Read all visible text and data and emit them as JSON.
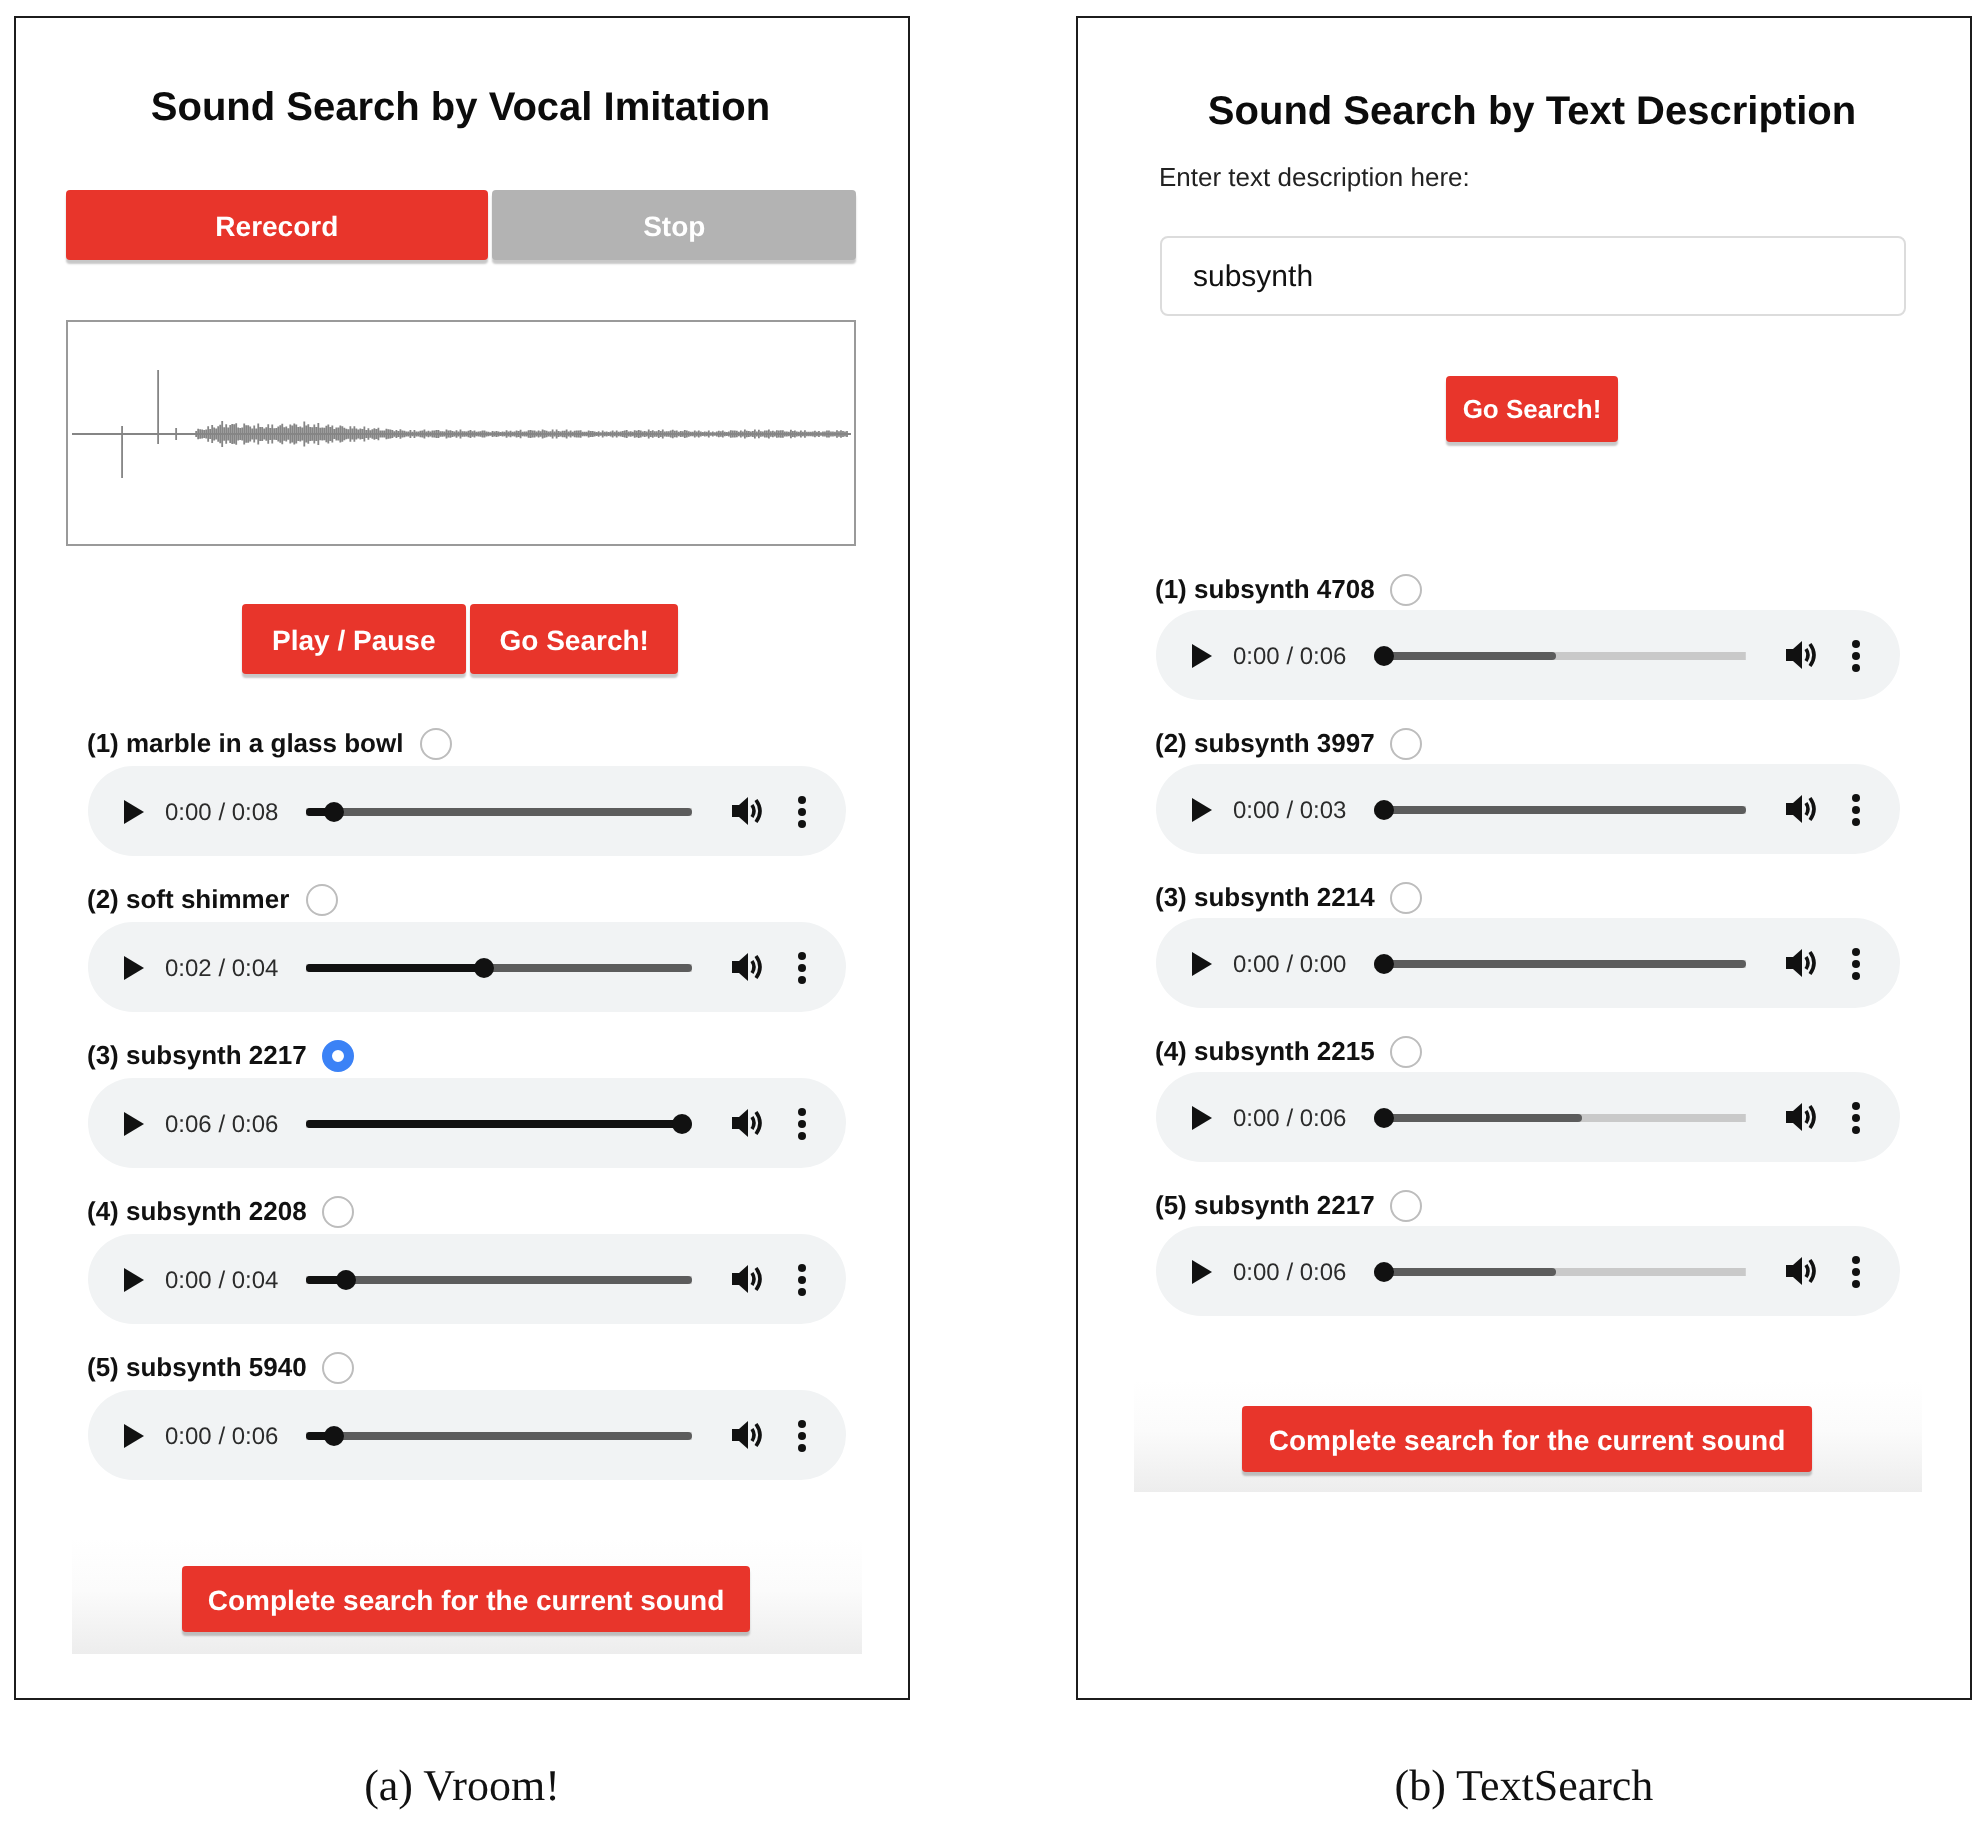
{
  "panels": [
    {
      "kind": "vocal",
      "title": "Sound Search by Vocal Imitation",
      "record_buttons": [
        {
          "label": "Rerecord",
          "disabled": false
        },
        {
          "label": "Stop",
          "disabled": true
        }
      ],
      "playback_buttons": [
        {
          "label": "Play / Pause"
        },
        {
          "label": "Go Search!"
        }
      ],
      "results": [
        {
          "label": "(1) marble in a glass bowl",
          "selected": false,
          "time": "0:00 / 0:08",
          "level": 0.05,
          "buffer": {
            "level": 1
          }
        },
        {
          "label": "(2) soft shimmer",
          "selected": false,
          "time": "0:02 / 0:04",
          "level": 0.46,
          "buffer": {
            "level": 1
          }
        },
        {
          "label": "(3) subsynth 2217",
          "selected": true,
          "time": "0:06 / 0:06",
          "level": 1,
          "buffer": {
            "level": 1
          }
        },
        {
          "label": "(4) subsynth 2208",
          "selected": false,
          "time": "0:00 / 0:04",
          "level": 0.08,
          "buffer": {
            "level": 1
          }
        },
        {
          "label": "(5) subsynth 5940",
          "selected": false,
          "time": "0:00 / 0:06",
          "level": 0.05,
          "buffer": {
            "level": 1
          }
        }
      ],
      "complete_button": "Complete search for the current sound",
      "caption": "(a) Vroom!"
    },
    {
      "kind": "text",
      "title": "Sound Search by Text Description",
      "field_label": "Enter text description here:",
      "search_field": {
        "value": "subsynth"
      },
      "search_button": "Go Search!",
      "results": [
        {
          "label": "(1) subsynth 4708",
          "selected": false,
          "time": "0:00 / 0:06",
          "level": 0,
          "buffer": {
            "level": 0.49
          }
        },
        {
          "label": "(2) subsynth 3997",
          "selected": false,
          "time": "0:00 / 0:03",
          "level": 0,
          "buffer": {
            "level": 1
          }
        },
        {
          "label": "(3) subsynth 2214",
          "selected": false,
          "time": "0:00 / 0:00",
          "level": 0,
          "buffer": {
            "level": 1
          }
        },
        {
          "label": "(4) subsynth 2215",
          "selected": false,
          "time": "0:00 / 0:06",
          "level": 0,
          "buffer": {
            "level": 0.56
          }
        },
        {
          "label": "(5) subsynth 2217",
          "selected": false,
          "time": "0:00 / 0:06",
          "level": 0,
          "buffer": {
            "level": 0.49
          }
        }
      ],
      "complete_button": "Complete search for the current sound",
      "caption": "(b) TextSearch"
    }
  ]
}
